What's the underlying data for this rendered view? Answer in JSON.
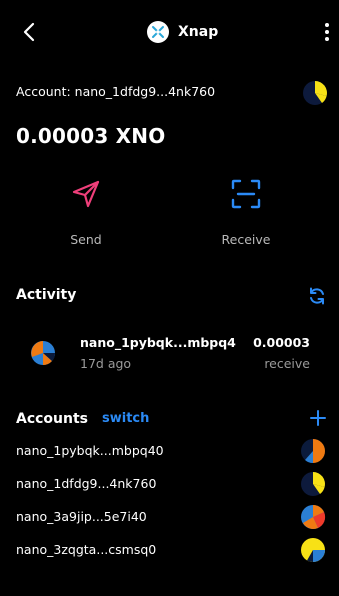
{
  "header": {
    "back_icon": "chevron-left-icon",
    "app_name": "Xnap",
    "menu_icon": "more-vertical-icon"
  },
  "account": {
    "label": "Account: nano_1dfdg9...4nk760"
  },
  "balance": "0.00003 XNO",
  "actions": {
    "send_label": "Send",
    "receive_label": "Receive"
  },
  "activity": {
    "title": "Activity",
    "items": [
      {
        "address": "nano_1pybqk...mbpq4",
        "time": "17d ago",
        "amount": "0.00003",
        "type": "receive"
      }
    ]
  },
  "accounts": {
    "title": "Accounts",
    "switch_label": "switch",
    "list": [
      {
        "label": "nano_1pybqk...mbpq40"
      },
      {
        "label": "nano_1dfdg9...4nk760"
      },
      {
        "label": "nano_3a9jip...5e7i40"
      },
      {
        "label": "nano_3zqgta...csmsq0"
      }
    ]
  },
  "colors": {
    "background": "#000000",
    "accent_blue": "#2b8af5",
    "send_pink": "#ef3f7a"
  }
}
